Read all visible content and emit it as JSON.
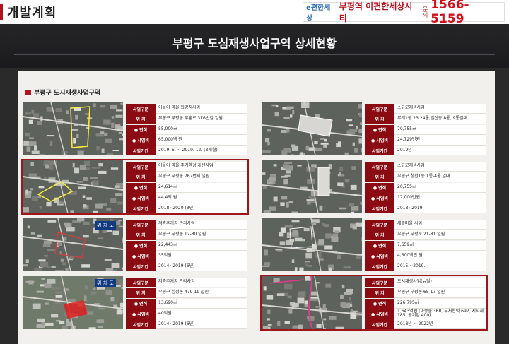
{
  "header": {
    "title": "개발계획",
    "promo_brand": "e편한세상",
    "promo_site": "부평역 이편한세상시티",
    "promo_ask": "문의",
    "promo_phone": "1566-5159"
  },
  "banner": {
    "title": "부평구 도심재생사업구역 상세현황"
  },
  "section": {
    "title": "부평구 도시재생사업구역"
  },
  "labels": {
    "project_type": "사업구분",
    "location": "위 치",
    "area": "● 면적",
    "cost": "● 사업비",
    "period": "사업기간"
  },
  "projects": [
    {
      "type": "어울어 마을 회망지사업",
      "location": "부평구 부평동 부흥로 376번길 일원",
      "area": "55,000㎡",
      "cost": "65,000백 원",
      "period": "2019. 5. ~ 2019. 12. (8개월)",
      "map_tag": ""
    },
    {
      "type": "어울어 마을 주거환경 개선사업",
      "location": "부평구 부평동 767번지 일원",
      "area": "24,614㎡",
      "cost": "44.4억 원",
      "period": "2018~2020 (3년)",
      "map_tag": ""
    },
    {
      "type": "저층주거지 관리사업",
      "location": "부평구 부평동 12-80 일원",
      "area": "22,443㎡",
      "cost": "35억원",
      "period": "2014~2019 (6년)",
      "map_tag": "위 치 도"
    },
    {
      "type": "저층주거지 관리사업",
      "location": "부평구 십정동 479-19 일원",
      "area": "13,690㎡",
      "cost": "40억원",
      "period": "2014~2019 (6년)",
      "map_tag": "위 치 도"
    },
    {
      "type": "소규모재생사업",
      "location": "부개1동 23,24통,일신동 8통, 9통일대",
      "area": "70,755㎡",
      "cost": "24,729만원",
      "period": "2019년",
      "map_tag": ""
    },
    {
      "type": "소규모재생사업",
      "location": "부평구 청천1동 1통-4통 일대",
      "area": "20,755㎡",
      "cost": "17,000만원",
      "period": "2018~2019",
      "map_tag": ""
    },
    {
      "type": "새뜰마을 사업",
      "location": "부평구 부평로 21-81 일원",
      "area": "7,659㎡",
      "cost": "4,500백만 원",
      "period": "2015.~2019.",
      "map_tag": ""
    },
    {
      "type": "도시재생사업(뉴딜)",
      "location": "부평구 부평동 65-17 일원",
      "area": "226,795㎡",
      "cost": "1,643억원 (마중물 360, 부처협력 697, 지자체 185, 공기업 400)",
      "period": "2018년 ~ 2022년",
      "map_tag": ""
    }
  ]
}
